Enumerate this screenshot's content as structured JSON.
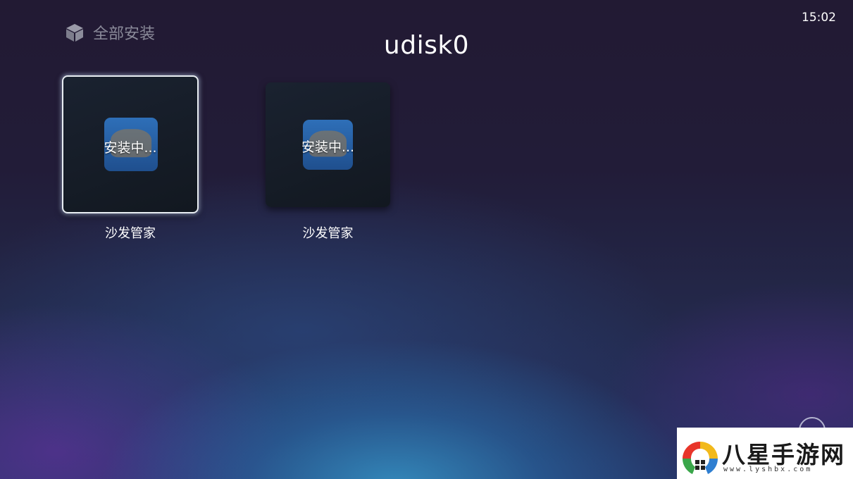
{
  "header": {
    "filter_label": "全部安装",
    "filter_icon": "cube-icon",
    "title": "udisk0",
    "clock": "15:02"
  },
  "apps": [
    {
      "name": "沙发管家",
      "status": "安装中...",
      "focused": true
    },
    {
      "name": "沙发管家",
      "status": "安装中...",
      "focused": false
    }
  ],
  "watermark": {
    "text": "八星手游网",
    "url": "www.lyshbx.com"
  },
  "colors": {
    "background_top": "#221a33",
    "background_bottom": "#263567",
    "focus_border": "#e9eef3",
    "app_icon_blue": "#2e6fb8"
  }
}
